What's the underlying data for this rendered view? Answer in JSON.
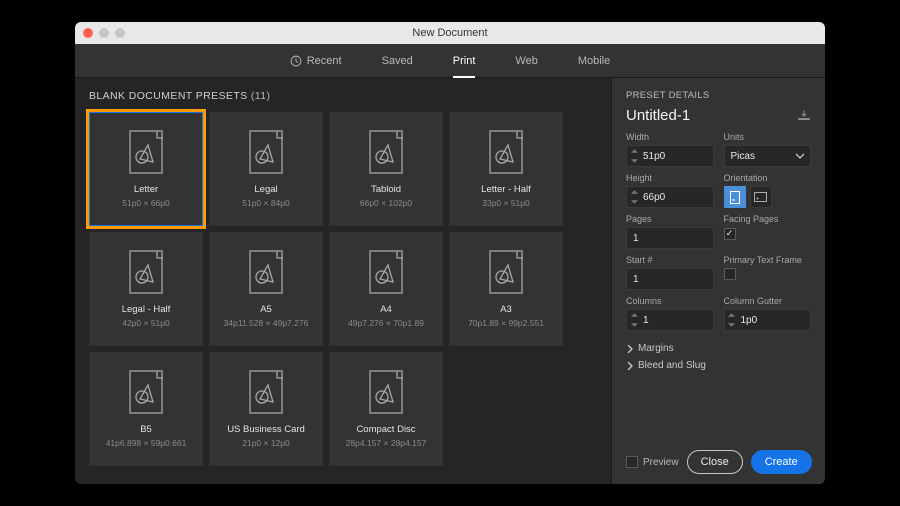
{
  "window": {
    "title": "New Document"
  },
  "tabs": {
    "recent": "Recent",
    "saved": "Saved",
    "print": "Print",
    "web": "Web",
    "mobile": "Mobile"
  },
  "blank": {
    "heading": "BLANK DOCUMENT PRESETS",
    "count": "(11)",
    "cards": [
      {
        "name": "Letter",
        "dim": "51p0 × 66p0"
      },
      {
        "name": "Legal",
        "dim": "51p0 × 84p0"
      },
      {
        "name": "Tabloid",
        "dim": "66p0 × 102p0"
      },
      {
        "name": "Letter - Half",
        "dim": "33p0 × 51p0"
      },
      {
        "name": "Legal - Half",
        "dim": "42p0 × 51p0"
      },
      {
        "name": "A5",
        "dim": "34p11.528 × 49p7.276"
      },
      {
        "name": "A4",
        "dim": "49p7.276 × 70p1.89"
      },
      {
        "name": "A3",
        "dim": "70p1.89 × 99p2.551"
      },
      {
        "name": "B5",
        "dim": "41p6.898 × 59p0.661"
      },
      {
        "name": "US Business Card",
        "dim": "21p0 × 12p0"
      },
      {
        "name": "Compact Disc",
        "dim": "28p4.157 × 28p4.157"
      }
    ]
  },
  "details": {
    "heading": "PRESET DETAILS",
    "docname": "Untitled-1",
    "width_lbl": "Width",
    "width": "51p0",
    "units_lbl": "Units",
    "units": "Picas",
    "height_lbl": "Height",
    "height": "66p0",
    "orient_lbl": "Orientation",
    "pages_lbl": "Pages",
    "pages": "1",
    "facing_lbl": "Facing Pages",
    "start_lbl": "Start #",
    "start": "1",
    "ptf_lbl": "Primary Text Frame",
    "cols_lbl": "Columns",
    "cols": "1",
    "gutter_lbl": "Column Gutter",
    "gutter": "1p0",
    "margins": "Margins",
    "bleed": "Bleed and Slug",
    "preview": "Preview",
    "close": "Close",
    "create": "Create"
  }
}
